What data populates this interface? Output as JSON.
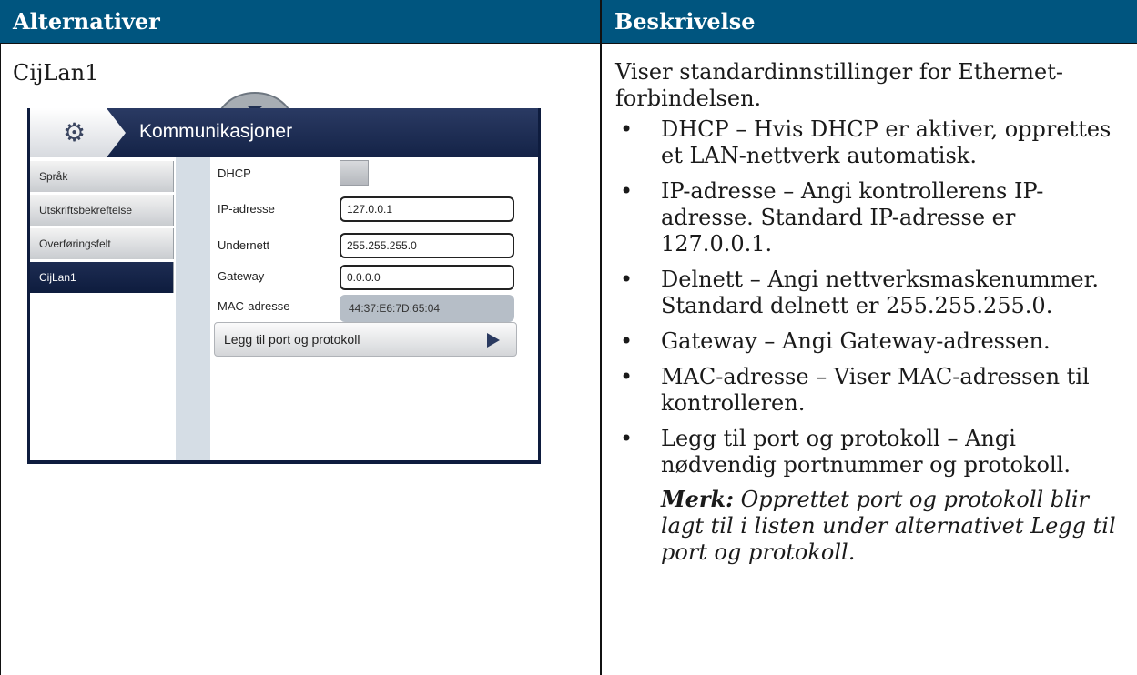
{
  "table": {
    "header_left": "Alternativer",
    "header_right": "Beskrivelse",
    "header_color": "#00557f"
  },
  "option_name": "CijLan1",
  "screenshot": {
    "title": "Kommunikasjoner",
    "title_icon": "gear-icon",
    "sidebar_items": [
      "Språk",
      "Utskriftsbekreftelse",
      "Overføringsfelt",
      "CijLan1"
    ],
    "active_item": "CijLan1",
    "fields": {
      "dhcp_label": "DHCP",
      "ip_label": "IP-adresse",
      "ip_value": "127.0.0.1",
      "subnet_label": "Undernett",
      "subnet_value": "255.255.255.0",
      "gateway_label": "Gateway",
      "gateway_value": "0.0.0.0",
      "mac_label": "MAC-adresse",
      "mac_value": "44:37:E6:7D:65:04"
    },
    "add_button": "Legg til port og protokoll"
  },
  "description": {
    "intro": "Viser standardinnstillinger for Ethernet-forbindelsen.",
    "bullets": [
      "DHCP – Hvis DHCP er aktiver, opprettes et LAN-nettverk automatisk.",
      "IP-adresse – Angi kontrollerens IP-adresse. Standard IP-adresse er 127.0.0.1.",
      "Delnett – Angi nettverksmaskenummer. Standard delnett er 255.255.255.0.",
      "Gateway – Angi Gateway-adressen.",
      "MAC-adresse – Viser MAC-adressen til kontrolleren.",
      "Legg til port og protokoll – Angi nødvendig portnummer og protokoll."
    ],
    "note_label": "Merk:",
    "note_text": "Opprettet port og protokoll blir lagt til i listen under alternativet Legg til port og protokoll."
  }
}
